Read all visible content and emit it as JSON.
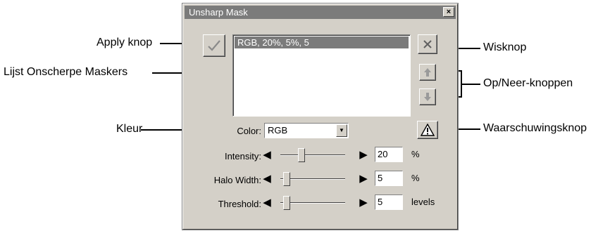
{
  "callouts": {
    "apply": "Apply knop",
    "list": "Lijst Onscherpe Maskers",
    "color": "Kleur",
    "delete": "Wisknop",
    "updown": "Op/Neer-knoppen",
    "warning": "Waarschuwingsknop"
  },
  "dialog": {
    "title": "Unsharp Mask",
    "close_glyph": "×",
    "list_items": [
      "RGB, 20%, 5%, 5"
    ],
    "color_label": "Color:",
    "color_value": "RGB",
    "sliders": [
      {
        "label": "Intensity:",
        "value": "20",
        "unit": "%",
        "level": 0.3
      },
      {
        "label": "Halo Width:",
        "value": "5",
        "unit": "%",
        "level": 0.05
      },
      {
        "label": "Threshold:",
        "value": "5",
        "unit": "levels",
        "level": 0.05
      }
    ]
  }
}
